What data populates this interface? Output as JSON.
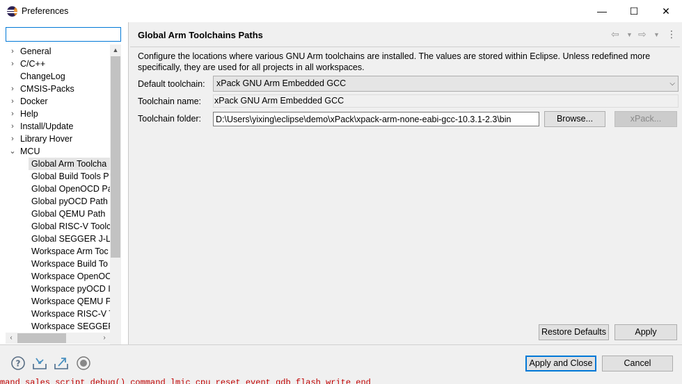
{
  "window": {
    "title": "Preferences",
    "minimize_glyph": "—",
    "maximize_glyph": "☐",
    "close_glyph": "✕"
  },
  "filter": {
    "value": "",
    "placeholder": ""
  },
  "tree": {
    "items": [
      {
        "label": "General",
        "expander": "›"
      },
      {
        "label": "C/C++",
        "expander": "›"
      },
      {
        "label": "ChangeLog",
        "expander": ""
      },
      {
        "label": "CMSIS-Packs",
        "expander": "›"
      },
      {
        "label": "Docker",
        "expander": "›"
      },
      {
        "label": "Help",
        "expander": "›"
      },
      {
        "label": "Install/Update",
        "expander": "›"
      },
      {
        "label": "Library Hover",
        "expander": "›"
      },
      {
        "label": "MCU",
        "expander": "⌄"
      }
    ],
    "mcu_children": [
      "Global Arm Toolcha",
      "Global Build Tools P",
      "Global OpenOCD Pa",
      "Global pyOCD Path",
      "Global QEMU Path",
      "Global RISC-V Toolc",
      "Global SEGGER J-Lin",
      "Workspace Arm Toc",
      "Workspace Build To",
      "Workspace OpenOC",
      "Workspace pyOCD I",
      "Workspace QEMU P",
      "Workspace RISC-V T",
      "Workspace SEGGER"
    ],
    "selected_index": 0
  },
  "page": {
    "title": "Global Arm Toolchains Paths",
    "description": "Configure the locations where various GNU Arm toolchains are installed. The values are stored within Eclipse. Unless redefined more specifically, they are used for all projects in all workspaces.",
    "default_toolchain_label": "Default toolchain:",
    "default_toolchain_value": "xPack GNU Arm Embedded GCC",
    "toolchain_name_label": "Toolchain name:",
    "toolchain_name_value": "xPack GNU Arm Embedded GCC",
    "toolchain_folder_label": "Toolchain folder:",
    "toolchain_folder_value": "D:\\Users\\yixing\\eclipse\\demo\\xPack\\xpack-arm-none-eabi-gcc-10.3.1-2.3\\bin",
    "browse_label": "Browse...",
    "xpack_label": "xPack...",
    "restore_defaults_label": "Restore Defaults",
    "apply_label": "Apply"
  },
  "nav_icons": [
    "back-icon",
    "back-menu-icon",
    "forward-icon",
    "forward-menu-icon",
    "view-menu-icon"
  ],
  "footer": {
    "apply_close_label": "Apply and Close",
    "cancel_label": "Cancel",
    "icons": [
      "help-icon",
      "import-icon",
      "export-icon",
      "record-icon"
    ]
  },
  "console_text": "mand sales script debug() command  lmic cpu reset  event gdb flash write end"
}
